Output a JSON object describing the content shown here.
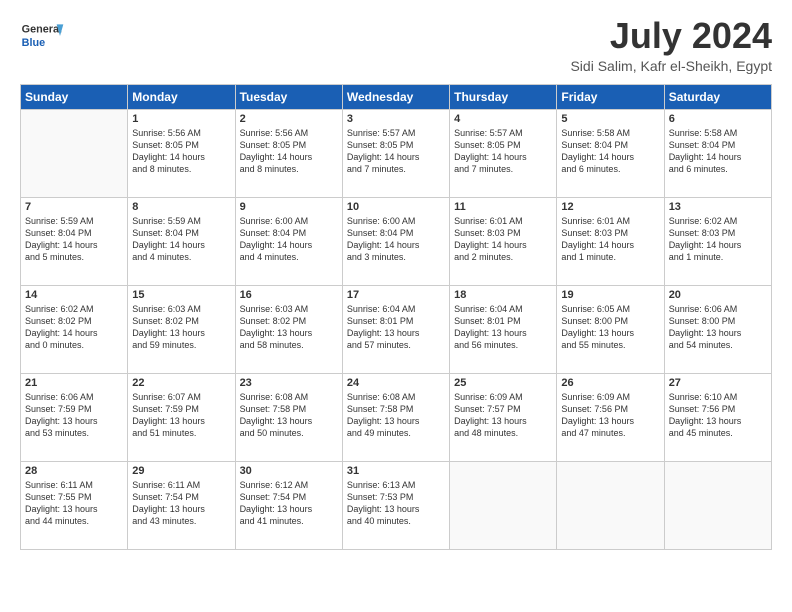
{
  "header": {
    "logo_general": "General",
    "logo_blue": "Blue",
    "month": "July 2024",
    "location": "Sidi Salim, Kafr el-Sheikh, Egypt"
  },
  "weekdays": [
    "Sunday",
    "Monday",
    "Tuesday",
    "Wednesday",
    "Thursday",
    "Friday",
    "Saturday"
  ],
  "weeks": [
    [
      {
        "day": "",
        "info": ""
      },
      {
        "day": "1",
        "info": "Sunrise: 5:56 AM\nSunset: 8:05 PM\nDaylight: 14 hours\nand 8 minutes."
      },
      {
        "day": "2",
        "info": "Sunrise: 5:56 AM\nSunset: 8:05 PM\nDaylight: 14 hours\nand 8 minutes."
      },
      {
        "day": "3",
        "info": "Sunrise: 5:57 AM\nSunset: 8:05 PM\nDaylight: 14 hours\nand 7 minutes."
      },
      {
        "day": "4",
        "info": "Sunrise: 5:57 AM\nSunset: 8:05 PM\nDaylight: 14 hours\nand 7 minutes."
      },
      {
        "day": "5",
        "info": "Sunrise: 5:58 AM\nSunset: 8:04 PM\nDaylight: 14 hours\nand 6 minutes."
      },
      {
        "day": "6",
        "info": "Sunrise: 5:58 AM\nSunset: 8:04 PM\nDaylight: 14 hours\nand 6 minutes."
      }
    ],
    [
      {
        "day": "7",
        "info": "Sunrise: 5:59 AM\nSunset: 8:04 PM\nDaylight: 14 hours\nand 5 minutes."
      },
      {
        "day": "8",
        "info": "Sunrise: 5:59 AM\nSunset: 8:04 PM\nDaylight: 14 hours\nand 4 minutes."
      },
      {
        "day": "9",
        "info": "Sunrise: 6:00 AM\nSunset: 8:04 PM\nDaylight: 14 hours\nand 4 minutes."
      },
      {
        "day": "10",
        "info": "Sunrise: 6:00 AM\nSunset: 8:04 PM\nDaylight: 14 hours\nand 3 minutes."
      },
      {
        "day": "11",
        "info": "Sunrise: 6:01 AM\nSunset: 8:03 PM\nDaylight: 14 hours\nand 2 minutes."
      },
      {
        "day": "12",
        "info": "Sunrise: 6:01 AM\nSunset: 8:03 PM\nDaylight: 14 hours\nand 1 minute."
      },
      {
        "day": "13",
        "info": "Sunrise: 6:02 AM\nSunset: 8:03 PM\nDaylight: 14 hours\nand 1 minute."
      }
    ],
    [
      {
        "day": "14",
        "info": "Sunrise: 6:02 AM\nSunset: 8:02 PM\nDaylight: 14 hours\nand 0 minutes."
      },
      {
        "day": "15",
        "info": "Sunrise: 6:03 AM\nSunset: 8:02 PM\nDaylight: 13 hours\nand 59 minutes."
      },
      {
        "day": "16",
        "info": "Sunrise: 6:03 AM\nSunset: 8:02 PM\nDaylight: 13 hours\nand 58 minutes."
      },
      {
        "day": "17",
        "info": "Sunrise: 6:04 AM\nSunset: 8:01 PM\nDaylight: 13 hours\nand 57 minutes."
      },
      {
        "day": "18",
        "info": "Sunrise: 6:04 AM\nSunset: 8:01 PM\nDaylight: 13 hours\nand 56 minutes."
      },
      {
        "day": "19",
        "info": "Sunrise: 6:05 AM\nSunset: 8:00 PM\nDaylight: 13 hours\nand 55 minutes."
      },
      {
        "day": "20",
        "info": "Sunrise: 6:06 AM\nSunset: 8:00 PM\nDaylight: 13 hours\nand 54 minutes."
      }
    ],
    [
      {
        "day": "21",
        "info": "Sunrise: 6:06 AM\nSunset: 7:59 PM\nDaylight: 13 hours\nand 53 minutes."
      },
      {
        "day": "22",
        "info": "Sunrise: 6:07 AM\nSunset: 7:59 PM\nDaylight: 13 hours\nand 51 minutes."
      },
      {
        "day": "23",
        "info": "Sunrise: 6:08 AM\nSunset: 7:58 PM\nDaylight: 13 hours\nand 50 minutes."
      },
      {
        "day": "24",
        "info": "Sunrise: 6:08 AM\nSunset: 7:58 PM\nDaylight: 13 hours\nand 49 minutes."
      },
      {
        "day": "25",
        "info": "Sunrise: 6:09 AM\nSunset: 7:57 PM\nDaylight: 13 hours\nand 48 minutes."
      },
      {
        "day": "26",
        "info": "Sunrise: 6:09 AM\nSunset: 7:56 PM\nDaylight: 13 hours\nand 47 minutes."
      },
      {
        "day": "27",
        "info": "Sunrise: 6:10 AM\nSunset: 7:56 PM\nDaylight: 13 hours\nand 45 minutes."
      }
    ],
    [
      {
        "day": "28",
        "info": "Sunrise: 6:11 AM\nSunset: 7:55 PM\nDaylight: 13 hours\nand 44 minutes."
      },
      {
        "day": "29",
        "info": "Sunrise: 6:11 AM\nSunset: 7:54 PM\nDaylight: 13 hours\nand 43 minutes."
      },
      {
        "day": "30",
        "info": "Sunrise: 6:12 AM\nSunset: 7:54 PM\nDaylight: 13 hours\nand 41 minutes."
      },
      {
        "day": "31",
        "info": "Sunrise: 6:13 AM\nSunset: 7:53 PM\nDaylight: 13 hours\nand 40 minutes."
      },
      {
        "day": "",
        "info": ""
      },
      {
        "day": "",
        "info": ""
      },
      {
        "day": "",
        "info": ""
      }
    ]
  ]
}
